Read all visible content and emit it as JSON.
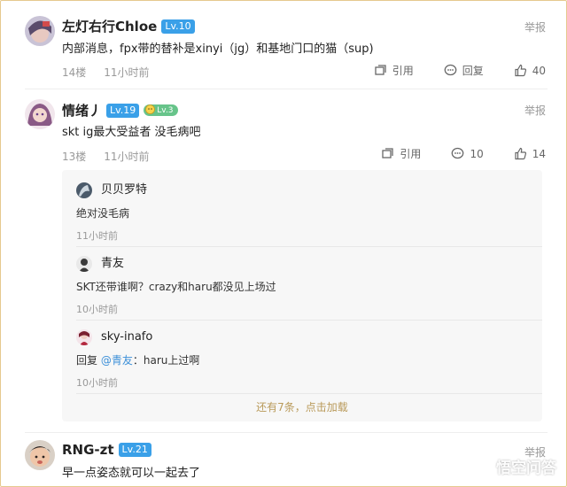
{
  "comments": [
    {
      "user": "左灯右行Chloe",
      "level": "Lv.10",
      "report": "举报",
      "text": "内部消息，fpx带的替补是xinyi（jg）和基地门口的猫（sup)",
      "floor": "14楼",
      "time": "11小时前",
      "quote_label": "引用",
      "reply_label": "回复",
      "likes": "40"
    },
    {
      "user": "情绪丿",
      "level": "Lv.19",
      "badge": "Lv.3",
      "report": "举报",
      "text": "skt ig最大受益者 没毛病吧",
      "floor": "13楼",
      "time": "11小时前",
      "quote_label": "引用",
      "reply_count": "10",
      "likes": "14",
      "replies": [
        {
          "user": "贝贝罗特",
          "text": "绝对没毛病",
          "time": "11小时前"
        },
        {
          "user": "青友",
          "text": "SKT还带谁啊？crazy和haru都没见上场过",
          "time": "10小时前"
        },
        {
          "user": "sky-inafo",
          "reply_prefix": "回复",
          "mention": "@青友",
          "colon": "：",
          "text": "haru上过啊",
          "time": "10小时前"
        }
      ],
      "load_more": "还有7条，点击加载"
    },
    {
      "user": "RNG-zt",
      "level": "Lv.21",
      "report": "举报",
      "text": "早一点姿态就可以一起去了"
    }
  ],
  "watermark": "悟空问答",
  "colors": {
    "level_badge": "#3aa0e8",
    "fan_badge": "#67c48a",
    "load_more": "#b99a5a",
    "mention": "#3b8fd8"
  },
  "icons": [
    "quote-icon",
    "reply-bubble-icon",
    "thumb-up-icon",
    "fan-badge-icon"
  ]
}
